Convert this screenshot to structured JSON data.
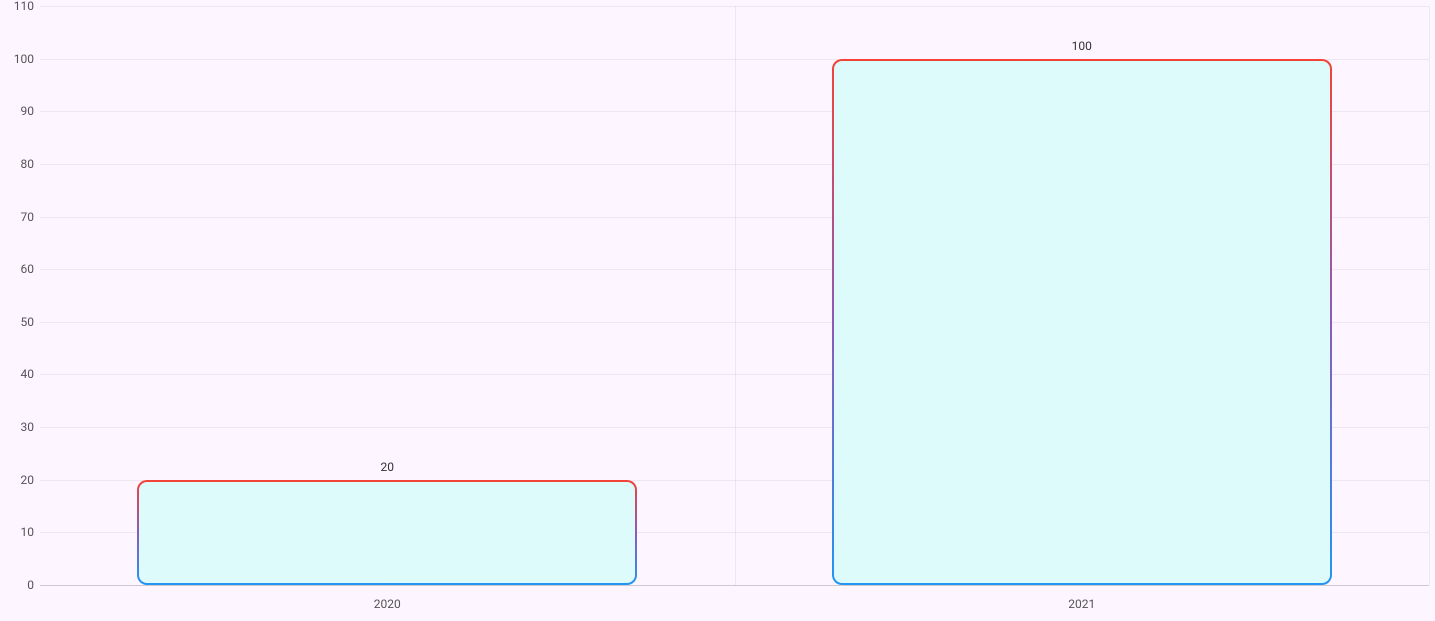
{
  "chart_data": {
    "type": "bar",
    "categories": [
      "2020",
      "2021"
    ],
    "values": [
      20,
      100
    ],
    "value_labels": [
      "20",
      "100"
    ],
    "ylim": [
      0,
      110
    ],
    "yticks": [
      0,
      10,
      20,
      30,
      40,
      50,
      60,
      70,
      80,
      90,
      100,
      110
    ],
    "ytick_labels": [
      "0",
      "10",
      "20",
      "30",
      "40",
      "50",
      "60",
      "70",
      "80",
      "90",
      "100",
      "110"
    ],
    "bar_fill": "#defbfb",
    "bar_stroke_top": "#f44336",
    "bar_stroke_bottom": "#2196f3",
    "background": "#fdf5ff"
  }
}
